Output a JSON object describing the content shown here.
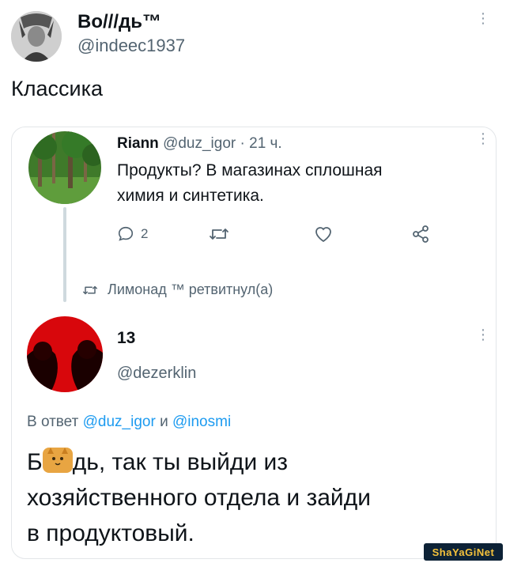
{
  "outer_tweet": {
    "display_name": "Bo///дь™",
    "handle": "@indeec1937",
    "text": "Классика"
  },
  "quoted_thread": {
    "first_tweet": {
      "display_name": "Riann",
      "handle": "@duz_igor",
      "separator": "·",
      "time": "21 ч.",
      "text_line1": "Продукты? В магазинах сплошная",
      "text_line2": "химия и синтетика.",
      "actions": {
        "reply_count": "2"
      }
    },
    "retweet_notice": "Лимонад ™ ретвитнул(а)",
    "second_tweet": {
      "display_name": "13",
      "handle": "@dezerklin",
      "reply_to_prefix": "В ответ",
      "reply_to_user1": "@duz_igor",
      "reply_to_and": "и",
      "reply_to_user2": "@inosmi",
      "text_line1_start": "Б",
      "text_line1_rest": "дь, так ты выйди из",
      "text_line2": "хозяйственного отдела и зайди",
      "text_line3": "в продуктовый."
    }
  },
  "watermark": {
    "text": "ShaYaGiNet"
  },
  "colors": {
    "accent_link": "#1d9bf0",
    "muted": "#536471",
    "watermark_bg": "#0d2236",
    "watermark_fg": "#f6c33b"
  }
}
